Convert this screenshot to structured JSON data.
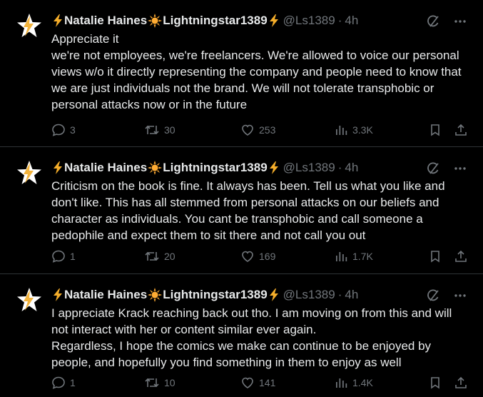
{
  "tweets": [
    {
      "author": {
        "name_part1": "Natalie Haines",
        "name_part2": "Lightningstar1389",
        "handle": "@Ls1389",
        "separator": "·",
        "time": "4h"
      },
      "paragraphs": [
        "Appreciate it",
        "we're not employees, we're freelancers. We're allowed to voice our personal views w/o it directly representing the company and people need to know that we are just individuals not the brand. We will not tolerate transphobic or personal attacks now or in the future"
      ],
      "stats": {
        "replies": "3",
        "reposts": "30",
        "likes": "253",
        "views": "3.3K"
      }
    },
    {
      "author": {
        "name_part1": "Natalie Haines",
        "name_part2": "Lightningstar1389",
        "handle": "@Ls1389",
        "separator": "·",
        "time": "4h"
      },
      "paragraphs": [
        "Criticism on the book is fine. It always has been. Tell us what you like and don't like. This has all stemmed from personal attacks on our beliefs and character as individuals. You cant be transphobic and call someone a pedophile and expect them to sit there and not call you out"
      ],
      "stats": {
        "replies": "1",
        "reposts": "20",
        "likes": "169",
        "views": "1.7K"
      }
    },
    {
      "author": {
        "name_part1": "Natalie Haines",
        "name_part2": "Lightningstar1389",
        "handle": "@Ls1389",
        "separator": "·",
        "time": "4h"
      },
      "paragraphs": [
        "I appreciate Krack reaching back out tho. I am moving on from this and will not interact with her or content similar ever again.",
        "Regardless, I hope the comics we make can continue to be enjoyed by people, and hopefully you find something in them to enjoy as well"
      ],
      "stats": {
        "replies": "1",
        "reposts": "10",
        "likes": "141",
        "views": "1.4K"
      }
    }
  ],
  "icons": {
    "name_emoji_lightning": "lightning-icon",
    "name_emoji_sun": "sun-icon",
    "grok": "grok-icon",
    "more": "more-icon",
    "reply": "reply-icon",
    "repost": "repost-icon",
    "like": "heart-icon",
    "views": "views-icon",
    "bookmark": "bookmark-icon",
    "share": "share-icon"
  },
  "colors": {
    "background": "#000000",
    "text_primary": "#e7e9ea",
    "text_secondary": "#71767b",
    "divider": "#2f3336",
    "lightning": "#f4ad2a",
    "sun": "#ffac33"
  }
}
